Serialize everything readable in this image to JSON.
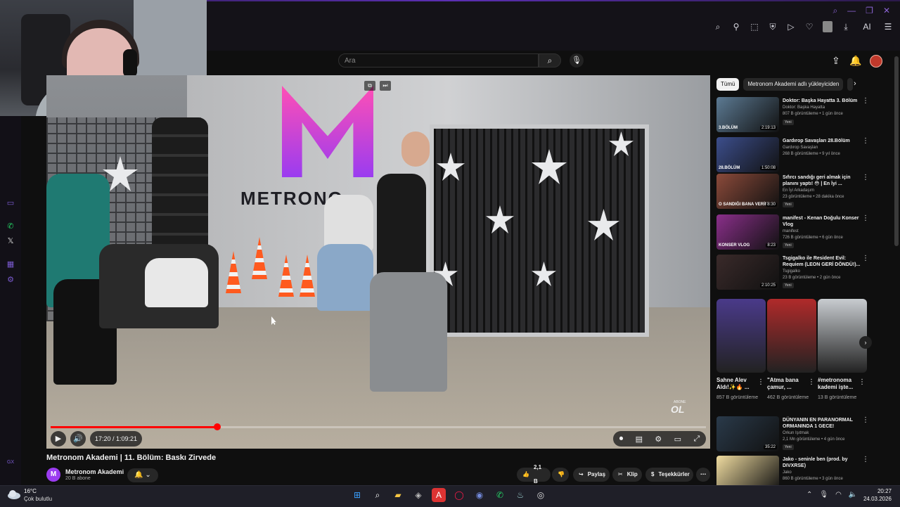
{
  "browser": {
    "window_controls": [
      "search",
      "minimize",
      "maximize",
      "close"
    ],
    "toolbar_ai_label": "AI"
  },
  "youtube": {
    "search": {
      "placeholder": "Ara"
    },
    "video": {
      "current_time": "17:20",
      "duration": "1:09:21",
      "time_label": "17:20 / 1:09:21",
      "progress": 0.254,
      "watermark_small": "ABONE",
      "watermark": "OL",
      "scene_logo_text": "METRONO"
    },
    "title": "Metronom Akademi | 11. Bölüm: Baskı Zirvede",
    "channel": {
      "name": "Metronom Akademi",
      "avatar_letter": "M",
      "subscribers": "20 B abone"
    },
    "actions": {
      "likes": "2,1 B",
      "share": "Paylaş",
      "clip": "Klip",
      "thanks": "Teşekkürler"
    },
    "chips": [
      "Tümü",
      "Metronom Akademi adlı yükleyiciden"
    ],
    "recommendations": [
      {
        "title": "Doktor: Başka Hayatta 3. Bölüm",
        "channel": "Doktor: Başka Hayatta",
        "meta": "807 B görüntüleme • 1 gün önce",
        "badge": "Yeni",
        "duration": "2:19:13",
        "thumb_color": "#5c7a93",
        "thumb_label": "3.BÖLÜM"
      },
      {
        "title": "Gardırop Savaşları 28.Bölüm",
        "channel": "Gardırop Savaşları",
        "meta": "268 B görüntüleme • 9 yıl önce",
        "badge": "",
        "duration": "1:50:08",
        "thumb_color": "#3c4e8c",
        "thumb_label": "28.BÖLÜM"
      },
      {
        "title": "Sıfırcı sandığı geri almak için planını yaptı! 😳 | En İyi ...",
        "channel": "En İyi Arkadaşım",
        "meta": "23 görüntüleme • 28 dakika önce",
        "badge": "Yeni",
        "duration": "8:30",
        "thumb_color": "#8b4a3a",
        "thumb_label": "O SANDIĞI BANA VERİN"
      },
      {
        "title": "manifest - Kenan Doğulu Konser Vlog",
        "channel": "manifest",
        "meta": "726 B görüntüleme • 6 gün önce",
        "badge": "Yeni",
        "duration": "8:23",
        "thumb_color": "#8a2f8a",
        "thumb_label": "KONSER VLOG"
      },
      {
        "title": "Tsgigalko ile Resident Evil: Requiem (LEON GERİ DÖNDÜ!)...",
        "channel": "Tsgigalko",
        "meta": "23 B görüntüleme • 2 gün önce",
        "badge": "Yeni",
        "duration": "2:10:25",
        "thumb_color": "#3a2a2a",
        "thumb_label": ""
      },
      {
        "title": "DÜNYANIN EN PARANORMAL ORMANINDA 1 GECE!",
        "channel": "Orkun Işıtmak",
        "meta": "2,1 Mn görüntüleme • 4 gün önce",
        "badge": "Yeni",
        "duration": "35:22",
        "thumb_color": "#2a3a4a",
        "thumb_label": ""
      },
      {
        "title": "Jako - seninle ben (prod. by DIVXRSE)",
        "channel": "Jako",
        "meta": "860 B görüntüleme • 3 gün önce",
        "badge": "",
        "duration": "",
        "thumb_color": "#f0dca0",
        "thumb_label": ""
      }
    ],
    "shorts": [
      {
        "title": "Sahne Alev Aldı!✨🔥 ...",
        "views": "857 B görüntüleme",
        "color": "#4a3a8a"
      },
      {
        "title": "\"Atma bana çamur, ...",
        "views": "462 B görüntüleme",
        "color": "#b02a2a"
      },
      {
        "title": "#metronoma kademi işte...",
        "views": "13 B görüntüleme",
        "color": "#c8ccd0"
      }
    ]
  },
  "taskbar": {
    "temperature": "16°C",
    "weather": "Çok bulutlu",
    "time": "20:27",
    "date": "24.03.2026"
  },
  "sidebar_label": "GX"
}
